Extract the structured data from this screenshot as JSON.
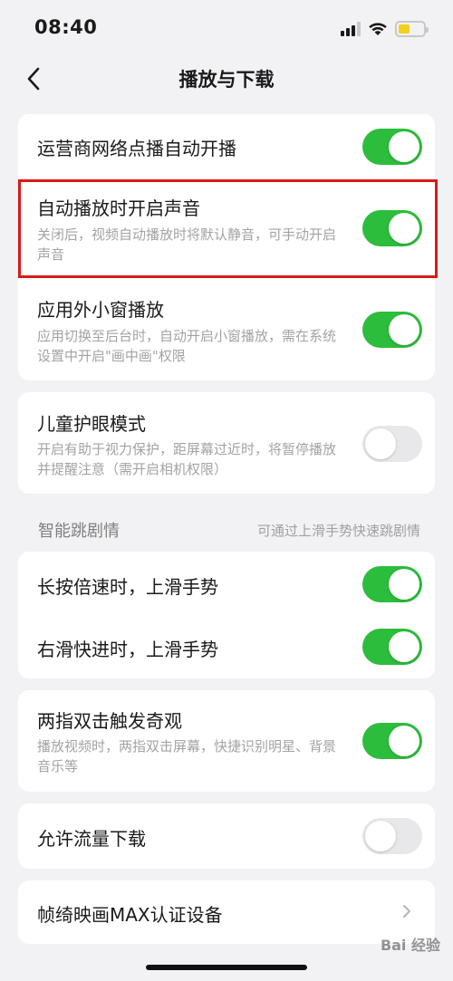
{
  "status_bar": {
    "time": "08:40",
    "icons": [
      "cellular-signal-icon",
      "wifi-icon",
      "battery-icon"
    ],
    "battery_color": "#f5cf1d"
  },
  "nav": {
    "title": "播放与下载",
    "back_icon": "chevron-left-icon"
  },
  "settings": {
    "carrier_autoplay": {
      "title": "运营商网络点播自动开播",
      "enabled": true
    },
    "autoplay_sound": {
      "title": "自动播放时开启声音",
      "desc": "关闭后，视频自动播放时将默认静音，可手动开启声音",
      "enabled": true
    },
    "pip": {
      "title": "应用外小窗播放",
      "desc": "应用切换至后台时，自动开启小窗播放，需在系统设置中开启\"画中画\"权限",
      "enabled": true
    },
    "kids_eye": {
      "title": "儿童护眼模式",
      "desc": "开启有助于视力保护，距屏幕过近时，将暂停播放并提醒注意（需开启相机权限）",
      "enabled": false
    },
    "smart_skip": {
      "label": "智能跳剧情",
      "hint": "可通过上滑手势快速跳剧情",
      "long_press": {
        "title": "长按倍速时，上滑手势",
        "enabled": true
      },
      "swipe_right": {
        "title": "右滑快进时，上滑手势",
        "enabled": true
      }
    },
    "two_finger": {
      "title": "两指双击触发奇观",
      "desc": "播放视频时，两指双击屏幕，快捷识别明星、背景音乐等",
      "enabled": true
    },
    "mobile_download": {
      "title": "允许流量下载",
      "enabled": false
    },
    "max_device": {
      "title": "帧绮映画MAX认证设备"
    }
  },
  "colors": {
    "toggle_on": "#2dbd3c",
    "toggle_off": "#e8e8ea",
    "highlight_border": "#d91a1a",
    "background": "#f2f2f4"
  },
  "watermark": "Bai 经验"
}
